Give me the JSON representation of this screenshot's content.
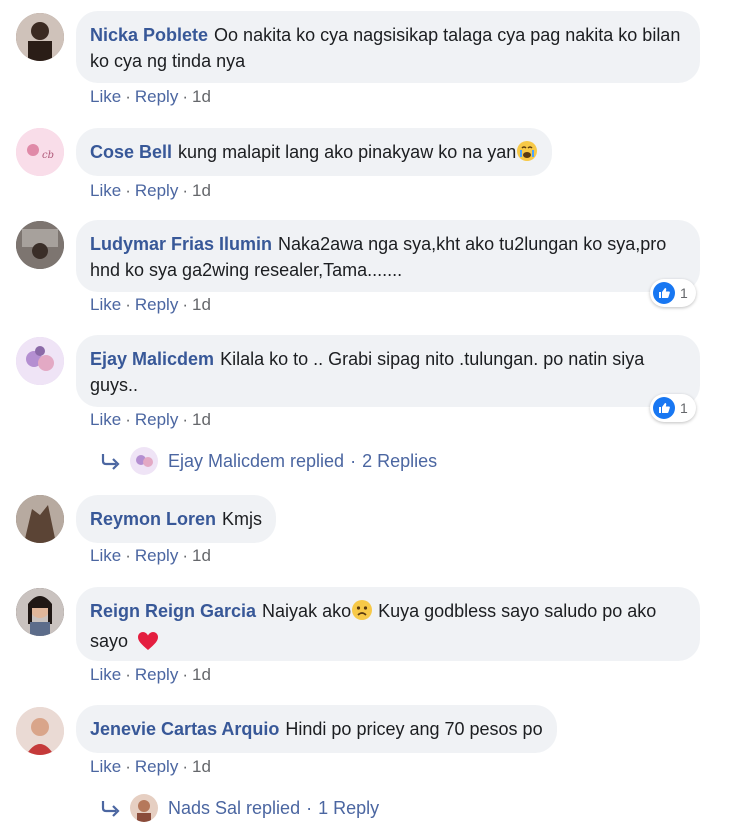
{
  "comments": [
    {
      "author": "Nicka Poblete",
      "text": "Oo nakita ko cya nagsisikap talaga cya pag nakita ko bilan ko cya ng tinda nya",
      "like": "Like",
      "reply": "Reply",
      "time": "1d",
      "avatar_color": "#8a6f62"
    },
    {
      "author": "Cose Bell",
      "text": "kung malapit lang ako pinakyaw ko na yan",
      "emoji": "crying-face",
      "like": "Like",
      "reply": "Reply",
      "time": "1d",
      "avatar_color": "#f4c6dc"
    },
    {
      "author": "Ludymar Frias Ilumin",
      "text": "Naka2awa nga sya,kht ako tu2lungan ko sya,pro hnd ko sya ga2wing resealer,Tama.......",
      "like": "Like",
      "reply": "Reply",
      "time": "1d",
      "reaction_count": "1",
      "avatar_color": "#5a5a5a"
    },
    {
      "author": "Ejay Malicdem",
      "text": "Kilala ko to .. Grabi sipag nito .tulungan. po natin siya guys..",
      "like": "Like",
      "reply": "Reply",
      "time": "1d",
      "reaction_count": "1",
      "avatar_color": "#d9c6e8",
      "replies_text": "Ejay Malicdem replied",
      "replies_count": "2 Replies"
    },
    {
      "author": "Reymon Loren",
      "text": "Kmjs",
      "like": "Like",
      "reply": "Reply",
      "time": "1d",
      "avatar_color": "#6e5a4e"
    },
    {
      "author": "Reign Reign Garcia",
      "text_before": "Naiyak ako",
      "text_after": " Kuya godbless sayo saludo po ako sayo",
      "like": "Like",
      "reply": "Reply",
      "time": "1d",
      "avatar_color": "#3c2f2a"
    },
    {
      "author": "Jenevie Cartas Arquio",
      "text": "Hindi po pricey ang 70 pesos po",
      "like": "Like",
      "reply": "Reply",
      "time": "1d",
      "avatar_color": "#e8d0c8",
      "replies_text": "Nads Sal replied",
      "replies_count": "1 Reply"
    }
  ],
  "colors": {
    "author": "#385898",
    "link": "#4b66a1",
    "meta": "#65676b",
    "bubble": "#f0f2f5",
    "like_badge": "#1877f2",
    "heart": "#e41e3f"
  }
}
